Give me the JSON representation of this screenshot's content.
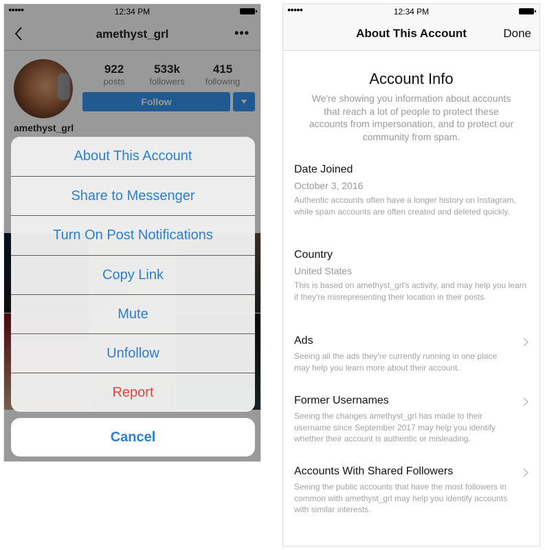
{
  "left_screen": {
    "status_bar": {
      "signal": "●●●●●",
      "time": "12:34 PM"
    },
    "nav": {
      "title": "amethyst_grl",
      "more": "•••"
    },
    "profile": {
      "stats": [
        {
          "value": "922",
          "label": "posts"
        },
        {
          "value": "533k",
          "label": "followers"
        },
        {
          "value": "415",
          "label": "following"
        }
      ],
      "follow_label": "Follow",
      "username": "amethyst_grl"
    },
    "action_sheet": {
      "items": [
        {
          "label": "About This Account",
          "style": "default"
        },
        {
          "label": "Share to Messenger",
          "style": "default"
        },
        {
          "label": "Turn On Post Notifications",
          "style": "default"
        },
        {
          "label": "Copy Link",
          "style": "default"
        },
        {
          "label": "Mute",
          "style": "default"
        },
        {
          "label": "Unfollow",
          "style": "default"
        },
        {
          "label": "Report",
          "style": "destructive"
        }
      ],
      "cancel_label": "Cancel"
    },
    "colors": {
      "action_blue": "#2a7fd4",
      "destructive_red": "#e0443a",
      "follow_blue": "#3897f0"
    }
  },
  "right_screen": {
    "status_bar": {
      "signal": "●●●●●",
      "time": "12:34 PM"
    },
    "nav": {
      "title": "About This Account",
      "done_label": "Done"
    },
    "heading": "Account Info",
    "intro": "We're showing you information about accounts that reach a lot of people to protect these accounts from impersonation, and to protect our community from spam.",
    "sections": [
      {
        "title": "Date Joined",
        "value": "October 3, 2016",
        "description": "Authentic accounts often have a longer history on Instagram, while spam accounts are often created and deleted quickly."
      },
      {
        "title": "Country",
        "value": "United States",
        "description": "This is based on amethyst_grl's activity, and may help you learn if they're misrepresenting their location in their posts."
      },
      {
        "title": "Ads",
        "description": "Seeing all the ads they're currently running in one place may help you learn more about their account.",
        "has_chevron": true
      },
      {
        "title": "Former Usernames",
        "description": "Seeing the changes amethyst_grl has made to their username since September 2017 may help you identify whether their account is authentic or misleading.",
        "has_chevron": true
      },
      {
        "title": "Accounts With Shared Followers",
        "description": "Seeing the public accounts that have the most followers in common with amethyst_grl may help you identify accounts with similar interests.",
        "has_chevron": true
      }
    ]
  }
}
